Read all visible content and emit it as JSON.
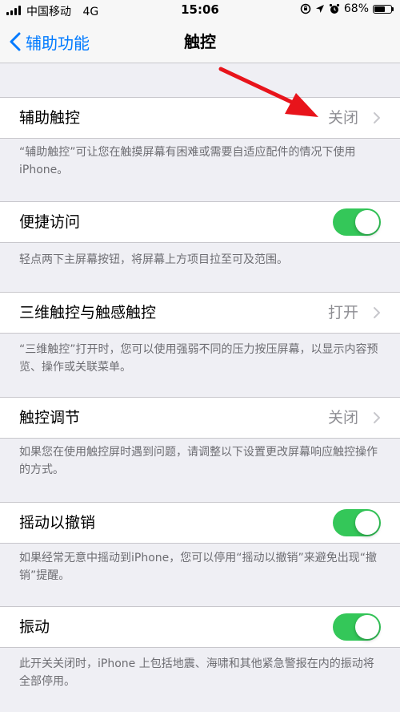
{
  "status_bar": {
    "carrier": "中国移动",
    "network": "4G",
    "time": "15:06",
    "battery_percent": "68%",
    "battery_level": 0.68
  },
  "nav": {
    "back_label": "辅助功能",
    "title": "触控"
  },
  "rows": [
    {
      "label": "辅助触控",
      "value": "关闭",
      "footer": "“辅助触控”可让您在触摸屏幕有困难或需要自适应配件的情况下使用 iPhone。"
    },
    {
      "label": "便捷访问",
      "toggle_on": true,
      "footer": "轻点两下主屏幕按钮，将屏幕上方项目拉至可及范围。"
    },
    {
      "label": "三维触控与触感触控",
      "value": "打开",
      "footer": "“三维触控”打开时，您可以使用强弱不同的压力按压屏幕，以显示内容预览、操作或关联菜单。"
    },
    {
      "label": "触控调节",
      "value": "关闭",
      "footer": "如果您在使用触控屏时遇到问题，请调整以下设置更改屏幕响应触控操作的方式。"
    },
    {
      "label": "摇动以撤销",
      "toggle_on": true,
      "footer": "如果经常无意中摇动到iPhone，您可以停用“摇动以撤销”来避免出现“撤销”提醒。"
    },
    {
      "label": "振动",
      "toggle_on": true,
      "footer": "此开关关闭时，iPhone 上包括地震、海啸和其他紧急警报在内的振动将全部停用。"
    }
  ],
  "colors": {
    "accent": "#007aff",
    "toggle_on": "#34c759",
    "annotation_arrow": "#e8141b"
  }
}
